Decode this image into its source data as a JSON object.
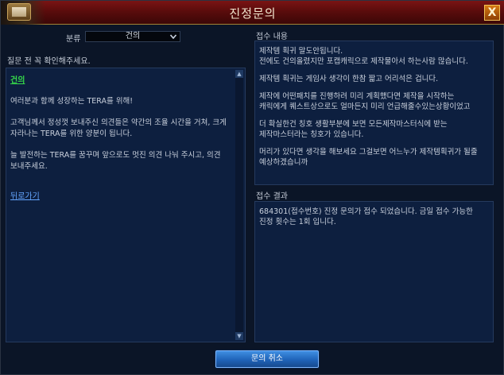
{
  "window": {
    "title": "진정문의",
    "close_label": "X"
  },
  "category": {
    "label": "분류",
    "selected": "건의"
  },
  "notice": "질문 전 꼭 확인해주세요.",
  "guide": {
    "heading": "건의",
    "paragraphs": [
      "여러분과 함께 성장하는 TERA를 위해!",
      "고객님께서 정성껏 보내주신 의견들은 약간의 조율 시간을 거쳐, 크게 자라나는 TERA를 위한 양분이 됩니다.",
      "늘 발전하는 TERA를 꿈꾸며 앞으로도 멋진 의견 나눠 주시고, 의견 보내주세요."
    ],
    "back_link": "뒤로가기"
  },
  "received": {
    "label": "접수 내용",
    "lines": [
      "제작템 획귀 말도안됩니다.",
      "전에도 건의올렸지만 포캡캐릭으로 제작물아서 하는사람 많습니다.",
      "",
      "제작템  획귀는 게임사 생각이 한참 짧고 어리석은 겁니다.",
      "",
      "제작에 어떤패치를 진행하려 미리 계획했다면 제작을 시작하는",
      "캐릭에게 퀘스트상으로도 얼마든지 미리 언급해줄수있는상황이었고",
      "",
      "더 확실한건 칭호 생활부분에 보면 모든제작마스터식에 받는",
      "제작마스터라는 칭호가 있습니다.",
      "",
      "머리가 있다면 생각을 해보세요 그걸보면 어느누가 제작템획귀가 될줄",
      "예상하겠습니까"
    ]
  },
  "result": {
    "label": "접수 결과",
    "lines": [
      "684301(접수번호) 진정 문의가 접수 되었습니다. 금일 접수 가능한",
      "진정 횟수는 1회 입니다."
    ]
  },
  "footer": {
    "cancel_label": "문의 취소"
  },
  "colors": {
    "title_bar": "#5a0c0c",
    "panel": "#0d1f3f",
    "heading_green": "#35d84a",
    "link_blue": "#64a6ff",
    "button_blue": "#1f63b8"
  }
}
